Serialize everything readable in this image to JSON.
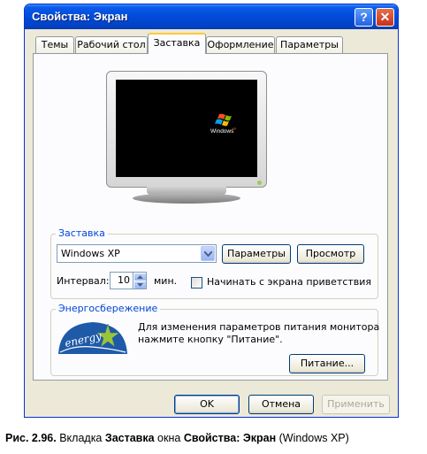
{
  "window": {
    "title": "Свойства: Экран",
    "help_glyph": "?",
    "close_glyph": "✕"
  },
  "tabs": [
    {
      "label": "Темы"
    },
    {
      "label": "Рабочий стол"
    },
    {
      "label": "Заставка",
      "active": true
    },
    {
      "label": "Оформление"
    },
    {
      "label": "Параметры"
    }
  ],
  "preview": {
    "logo_text": "Windows",
    "logo_sup": "XP"
  },
  "screensaver": {
    "group_label": "Заставка",
    "selected": "Windows XP",
    "settings_button": "Параметры",
    "preview_button": "Просмотр",
    "interval_label": "Интервал:",
    "interval_value": "10",
    "interval_unit": "мин.",
    "welcome_checkbox_label": "Начинать с экрана приветствия",
    "welcome_checked": false
  },
  "power": {
    "group_label": "Энергосбережение",
    "text_line1": "Для изменения параметров питания монитора",
    "text_line2": "нажмите кнопку \"Питание\".",
    "logo_text": "energy",
    "power_button": "Питание..."
  },
  "footer": {
    "ok": "OK",
    "cancel": "Отмена",
    "apply": "Применить"
  },
  "caption": {
    "prefix": "Рис. 2.96.",
    "t1": " Вкладка ",
    "b1": "Заставка",
    "t2": " окна ",
    "b2": "Свойства: Экран",
    "t3": " (Windows XP)"
  },
  "colors": {
    "titlebar": "#0a5ae9",
    "group_label": "#0046d5",
    "face": "#ece9d8"
  }
}
